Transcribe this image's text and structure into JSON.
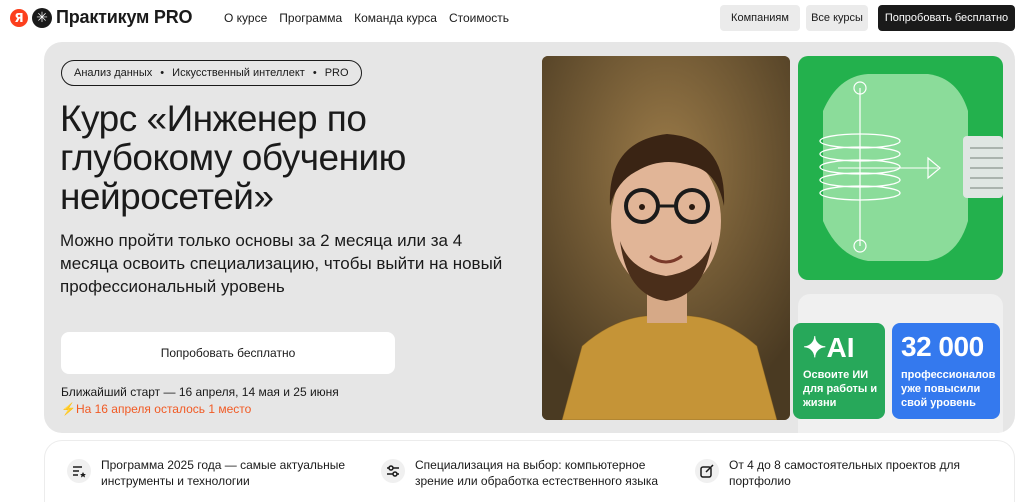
{
  "header": {
    "logo_letter": "Я",
    "brand": "Практикум PRO",
    "nav": [
      "О курсе",
      "Программа",
      "Команда курса",
      "Стоимость"
    ],
    "btn_companies": "Компаниям",
    "btn_courses": "Все курсы",
    "btn_try": "Попробовать бесплатно"
  },
  "hero": {
    "tags": [
      "Анализ данных",
      "Искусственный интеллект",
      "PRO"
    ],
    "title": "Курс «Инженер по глубокому обучению нейросетей»",
    "subtitle": "Можно пройти только основы за 2 месяца или за 4 месяца освоить специализацию, чтобы выйти на новый профессиональный уровень",
    "btn_try": "Попробовать бесплатно",
    "next_start": "Ближайший старт — 16 апреля, 14 мая и 25 июня",
    "seats_left": "На 16 апреля осталось 1 место",
    "card_ai": {
      "big": "AI",
      "text": "Освоите ИИ для работы и жизни"
    },
    "card_pros": {
      "big": "32 000",
      "text": "профессионалов уже повысили свой уровень"
    }
  },
  "features": [
    {
      "icon": "list-star-icon",
      "text": "Программа 2025 года — самые актуальные инструменты и технологии"
    },
    {
      "icon": "sliders-icon",
      "text": "Специализация на выбор: компьютерное зрение или обработка естественного языка"
    },
    {
      "icon": "pencil-square-icon",
      "text": "От 4 до 8 самостоятельных проектов для портфолио"
    }
  ],
  "colors": {
    "accent_dark": "#1a1a1a",
    "green": "#23b14d",
    "blue": "#3479ee",
    "warning": "#f15a24",
    "hero_bg": "#e6e6e6"
  }
}
